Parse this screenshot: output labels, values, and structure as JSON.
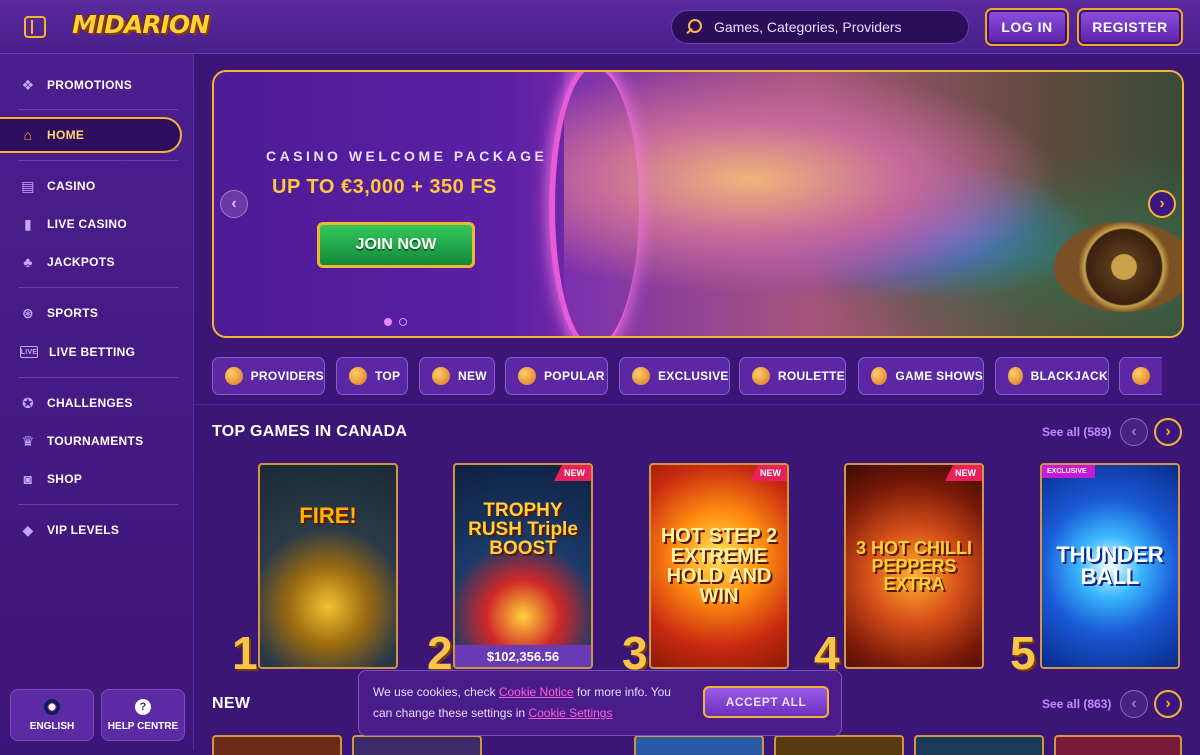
{
  "header": {
    "logo_text": "MIDARION",
    "search_placeholder": "Games, Categories, Providers",
    "login_label": "LOG IN",
    "register_label": "REGISTER"
  },
  "sidebar": {
    "items": [
      {
        "label": "PROMOTIONS",
        "icon": "gift-icon"
      },
      {
        "label": "HOME",
        "icon": "home-icon",
        "active": true
      },
      {
        "label": "CASINO",
        "icon": "slot-machine-icon"
      },
      {
        "label": "LIVE CASINO",
        "icon": "cards-icon"
      },
      {
        "label": "JACKPOTS",
        "icon": "clover-icon"
      },
      {
        "label": "SPORTS",
        "icon": "ball-icon"
      },
      {
        "label": "LIVE BETTING",
        "icon": "live-icon"
      },
      {
        "label": "CHALLENGES",
        "icon": "medal-icon"
      },
      {
        "label": "TOURNAMENTS",
        "icon": "trophy-icon"
      },
      {
        "label": "SHOP",
        "icon": "basket-icon"
      },
      {
        "label": "VIP LEVELS",
        "icon": "diamond-icon"
      }
    ],
    "language_label": "ENGLISH",
    "help_label": "HELP CENTRE"
  },
  "banner": {
    "subtitle": "CASINO WELCOME PACKAGE",
    "headline": "UP TO €3,000 + 350 FS",
    "cta_label": "JOIN NOW"
  },
  "categories": [
    {
      "label": "PROVIDERS"
    },
    {
      "label": "TOP"
    },
    {
      "label": "NEW"
    },
    {
      "label": "POPULAR"
    },
    {
      "label": "EXCLUSIVE"
    },
    {
      "label": "ROULETTE"
    },
    {
      "label": "GAME SHOWS"
    },
    {
      "label": "BLACKJACK"
    }
  ],
  "top_games": {
    "title": "TOP GAMES IN CANADA",
    "see_all": "See all (589)",
    "games": [
      {
        "rank": "1",
        "name": "FIRE!",
        "badge": ""
      },
      {
        "rank": "2",
        "name": "TROPHY RUSH Triple BOOST",
        "badge": "NEW",
        "prize": "$102,356.56"
      },
      {
        "rank": "3",
        "name": "HOT STEP 2 EXTREME HOLD AND WIN",
        "badge": "NEW"
      },
      {
        "rank": "4",
        "name": "3 HOT CHILLI PEPPERS EXTRA",
        "badge": "NEW"
      },
      {
        "rank": "5",
        "name": "THUNDER BALL",
        "badge": "EXCLUSIVE"
      }
    ]
  },
  "new_games": {
    "title": "NEW",
    "see_all": "See all (863)"
  },
  "cookie": {
    "text_before": "We use cookies, check ",
    "notice_link": "Cookie Notice",
    "text_middle": " for more info. You can change these settings in ",
    "settings_link": "Cookie Settings",
    "accept_label": "ACCEPT ALL"
  },
  "colors": {
    "accent_gold": "#f2b531",
    "background": "#3c1677",
    "new_badge": "#e6215b",
    "cta_green": "#34c759"
  }
}
